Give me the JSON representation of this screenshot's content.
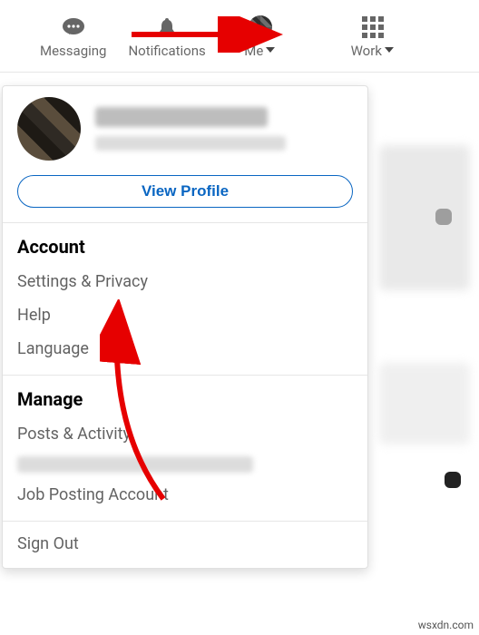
{
  "nav": {
    "messaging": "Messaging",
    "notifications": "Notifications",
    "me": "Me",
    "work": "Work"
  },
  "dropdown": {
    "view_profile": "View Profile",
    "sections": {
      "account": {
        "title": "Account",
        "settings_privacy": "Settings & Privacy",
        "help": "Help",
        "language": "Language"
      },
      "manage": {
        "title": "Manage",
        "posts_activity": "Posts & Activity",
        "job_posting": "Job Posting Account"
      },
      "sign_out": "Sign Out"
    }
  },
  "watermark": "wsxdn.com"
}
